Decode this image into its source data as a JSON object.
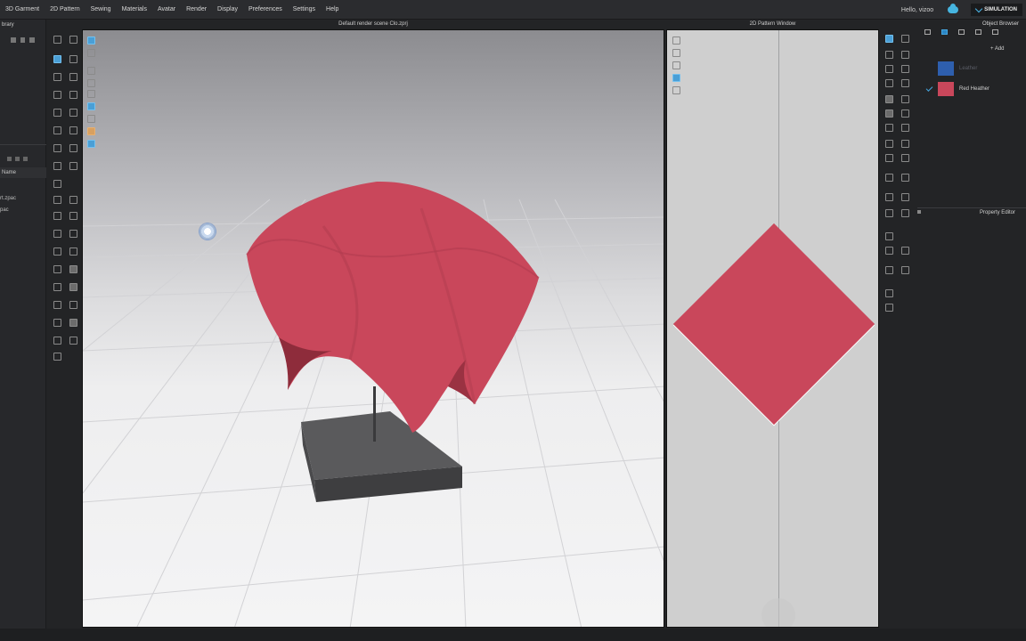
{
  "menu": {
    "items": [
      "3D Garment",
      "2D Pattern",
      "Sewing",
      "Materials",
      "Avatar",
      "Render",
      "Display",
      "Preferences",
      "Settings",
      "Help"
    ],
    "greeting": "Hello, vizoo",
    "simulation_label": "SIMULATION"
  },
  "library": {
    "title": "brary",
    "column_header": "Name",
    "files": [
      "rt.zpac",
      "pac"
    ]
  },
  "viewport3d": {
    "title": "Default render scene Clo.zprj"
  },
  "pattern_window": {
    "title": "2D Pattern Window",
    "shape_color": "#c9475b"
  },
  "object_browser": {
    "title": "Object Browser",
    "add_label": "+ Add",
    "fabrics": [
      {
        "label": "Leather",
        "color": "#2e5fae",
        "selected": false
      },
      {
        "label": "Red Heather",
        "color": "#c9475b",
        "selected": true
      }
    ]
  },
  "property_editor": {
    "title": "Property Editor"
  },
  "colors": {
    "accent": "#45a6e0",
    "fabric": "#c9475b"
  }
}
